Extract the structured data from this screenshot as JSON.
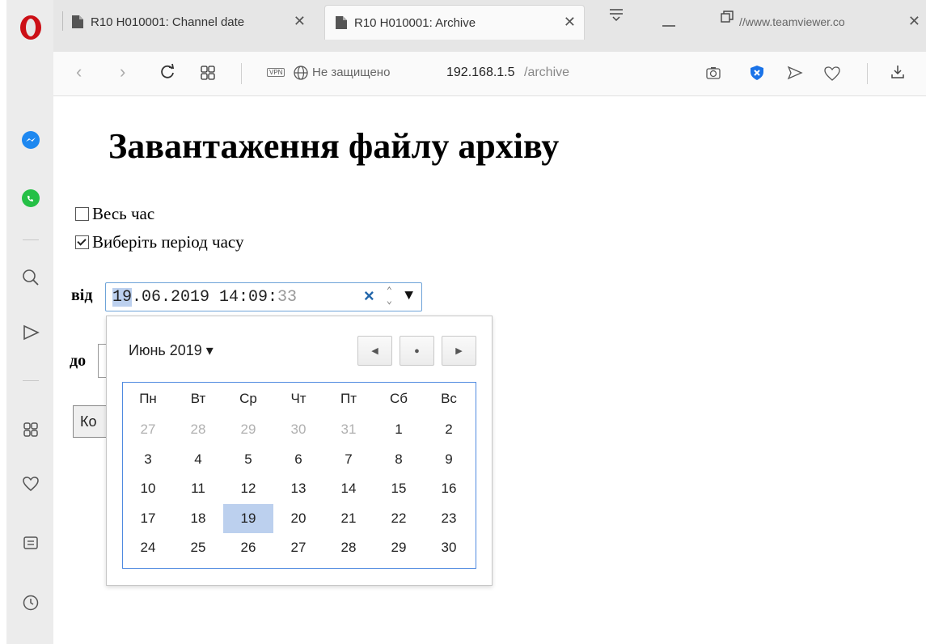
{
  "browser": {
    "tabs": [
      {
        "title": "R10 H010001: Channel date"
      },
      {
        "title": "R10 H010001: Archive"
      },
      {
        "title": "//www.teamviewer.co"
      }
    ],
    "address": {
      "vpn": "VPN",
      "security": "Не защищено",
      "host": "192.168.1.5",
      "path": "/archive"
    }
  },
  "page": {
    "title": "Завантаження файлу архіву",
    "options": [
      {
        "label": "Весь час",
        "checked": false
      },
      {
        "label": "Виберіть період часу",
        "checked": true
      }
    ],
    "from_label": "від",
    "to_label": "до",
    "from_value": {
      "day": "19",
      "rest": ".06.2019 14:09:",
      "seconds": "33"
    },
    "button_label": "Ко"
  },
  "calendar": {
    "month_label": "Июнь 2019 ▾",
    "weekdays": [
      "Пн",
      "Вт",
      "Ср",
      "Чт",
      "Пт",
      "Сб",
      "Вс"
    ],
    "weeks": [
      [
        "27",
        "28",
        "29",
        "30",
        "31",
        "1",
        "2"
      ],
      [
        "3",
        "4",
        "5",
        "6",
        "7",
        "8",
        "9"
      ],
      [
        "10",
        "11",
        "12",
        "13",
        "14",
        "15",
        "16"
      ],
      [
        "17",
        "18",
        "19",
        "20",
        "21",
        "22",
        "23"
      ],
      [
        "24",
        "25",
        "26",
        "27",
        "28",
        "29",
        "30"
      ]
    ],
    "other_month_first_row_count": 5,
    "selected": "19"
  }
}
